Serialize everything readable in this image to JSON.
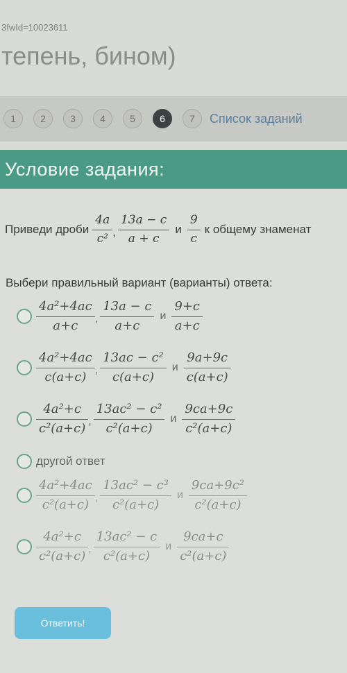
{
  "browser": {
    "url_fragment": "3fwId=10023611"
  },
  "page": {
    "heading": "тепень, бином)"
  },
  "steps": {
    "items": [
      {
        "label": "1",
        "active": false
      },
      {
        "label": "2",
        "active": false
      },
      {
        "label": "3",
        "active": false
      },
      {
        "label": "4",
        "active": false
      },
      {
        "label": "5",
        "active": false
      },
      {
        "label": "6",
        "active": true
      },
      {
        "label": "7",
        "active": false
      }
    ],
    "task_list_label": "Список заданий"
  },
  "task": {
    "header": "Условие задания:",
    "question": {
      "lead": "Приведи дроби",
      "fractions": [
        {
          "num": "4a",
          "den": "c²"
        },
        {
          "num": "13a − c",
          "den": "a + c"
        },
        {
          "num": "9",
          "den": "c"
        }
      ],
      "and_word": "и",
      "tail": "к общему знаменат"
    },
    "choose_label": "Выбери правильный вариант (варианты) ответа:",
    "and_word": "и",
    "options": [
      {
        "type": "fractions",
        "fractions": [
          {
            "num": "4a²+4ac",
            "den": "a+c"
          },
          {
            "num": "13a − c",
            "den": "a+c"
          },
          {
            "num": "9+c",
            "den": "a+c"
          }
        ]
      },
      {
        "type": "fractions",
        "fractions": [
          {
            "num": "4a²+4ac",
            "den": "c(a+c)"
          },
          {
            "num": "13ac − c²",
            "den": "c(a+c)"
          },
          {
            "num": "9a+9c",
            "den": "c(a+c)"
          }
        ]
      },
      {
        "type": "fractions",
        "fractions": [
          {
            "num": "4a²+c",
            "den": "c²(a+c)"
          },
          {
            "num": "13ac² − c²",
            "den": "c²(a+c)"
          },
          {
            "num": "9ca+9c",
            "den": "c²(a+c)"
          }
        ]
      },
      {
        "type": "text",
        "label": "другой ответ"
      },
      {
        "type": "fractions",
        "fractions": [
          {
            "num": "4a²+4ac",
            "den": "c²(a+c)"
          },
          {
            "num": "13ac² − c³",
            "den": "c²(a+c)"
          },
          {
            "num": "9ca+9c²",
            "den": "c²(a+c)"
          }
        ]
      },
      {
        "type": "fractions",
        "fractions": [
          {
            "num": "4a²+c",
            "den": "c²(a+c)"
          },
          {
            "num": "13ac² − c",
            "den": "c²(a+c)"
          },
          {
            "num": "9ca+c",
            "den": "c²(a+c)"
          }
        ]
      }
    ],
    "submit_label": "Ответить!"
  },
  "colors": {
    "header_bg": "#4a9b85",
    "active_step": "#3f4043",
    "link": "#5b7fa0",
    "submit_bg": "#69bfdc",
    "radio_border": "#6aa492"
  }
}
